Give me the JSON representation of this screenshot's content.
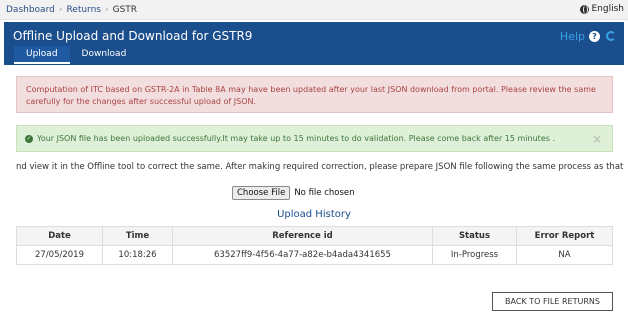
{
  "breadcrumb": {
    "items": [
      "Dashboard",
      "Returns"
    ],
    "current": "GSTR"
  },
  "language": {
    "label": "English"
  },
  "header": {
    "title": "Offline Upload and Download for GSTR9",
    "help_label": "Help",
    "tabs": [
      {
        "label": "Upload",
        "active": true
      },
      {
        "label": "Download",
        "active": false
      }
    ]
  },
  "alerts": {
    "danger": "Computation of ITC based on GSTR-2A in Table 8A may have been updated after your last JSON download from portal. Please review the same carefully for the changes after successful upload of JSON.",
    "success": "Your JSON file has been uploaded successfully.It may take up to 15 minutes to do validation. Please come back after 15 minutes ."
  },
  "instruction": "nd view it in the Offline tool to correct the same. After making required correction, please prepare JSON file following the same process as that for regular in",
  "file_input": {
    "button_label": "Choose File",
    "status": "No file chosen"
  },
  "history": {
    "title": "Upload History",
    "columns": [
      "Date",
      "Time",
      "Reference id",
      "Status",
      "Error Report"
    ],
    "rows": [
      {
        "date": "27/05/2019",
        "time": "10:18:26",
        "reference_id": "63527ff9-4f56-4a77-a82e-b4ada4341655",
        "status": "In-Progress",
        "error_report": "NA"
      }
    ]
  },
  "back_button": "BACK TO FILE RETURNS",
  "colors": {
    "header_bg": "#1a4e8c",
    "help": "#3aa0e8",
    "danger_bg": "#f2dede",
    "success_bg": "#dff0d8"
  },
  "icons": {
    "language": "globe-icon",
    "help": "help-icon",
    "refresh": "refresh-icon",
    "success": "check-circle-icon",
    "dismiss": "close-icon"
  }
}
